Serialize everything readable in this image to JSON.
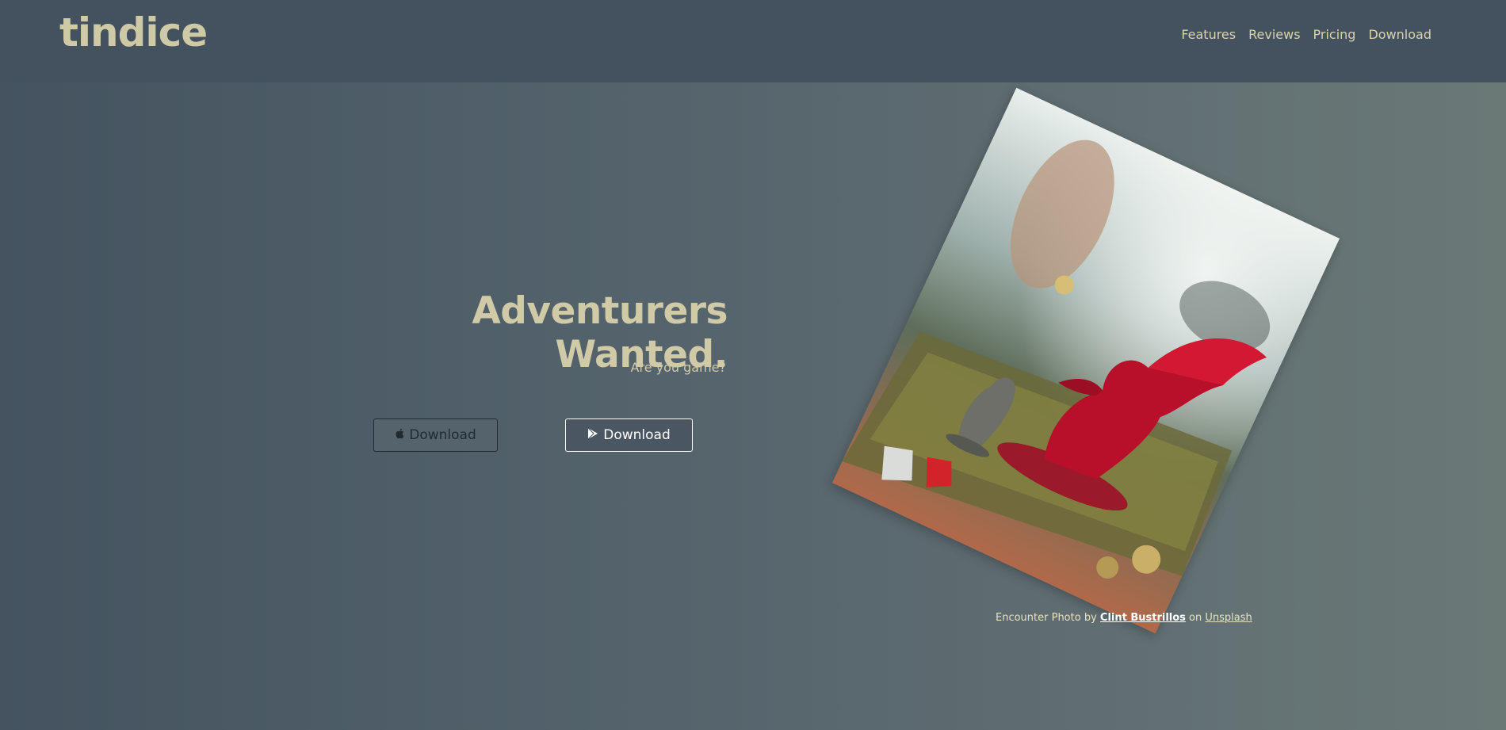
{
  "brand": {
    "logo": "tindice"
  },
  "nav": {
    "items": [
      {
        "label": "Features"
      },
      {
        "label": "Reviews"
      },
      {
        "label": "Pricing"
      },
      {
        "label": "Download"
      }
    ]
  },
  "hero": {
    "title": "Adventurers Wanted.",
    "subtitle": "Are you game?",
    "ios_button": "Download",
    "android_button": "Download"
  },
  "credit": {
    "prefix": "Encounter Photo by ",
    "author": "Clint Bustrillos",
    "middle": " on ",
    "site": "Unsplash"
  },
  "colors": {
    "navbar": "#44525f",
    "accent_text": "#d0caa6",
    "dragon": "#b8102a"
  },
  "icons": {
    "ios_button_icon": "apple-icon",
    "android_button_icon": "google-play-icon"
  }
}
